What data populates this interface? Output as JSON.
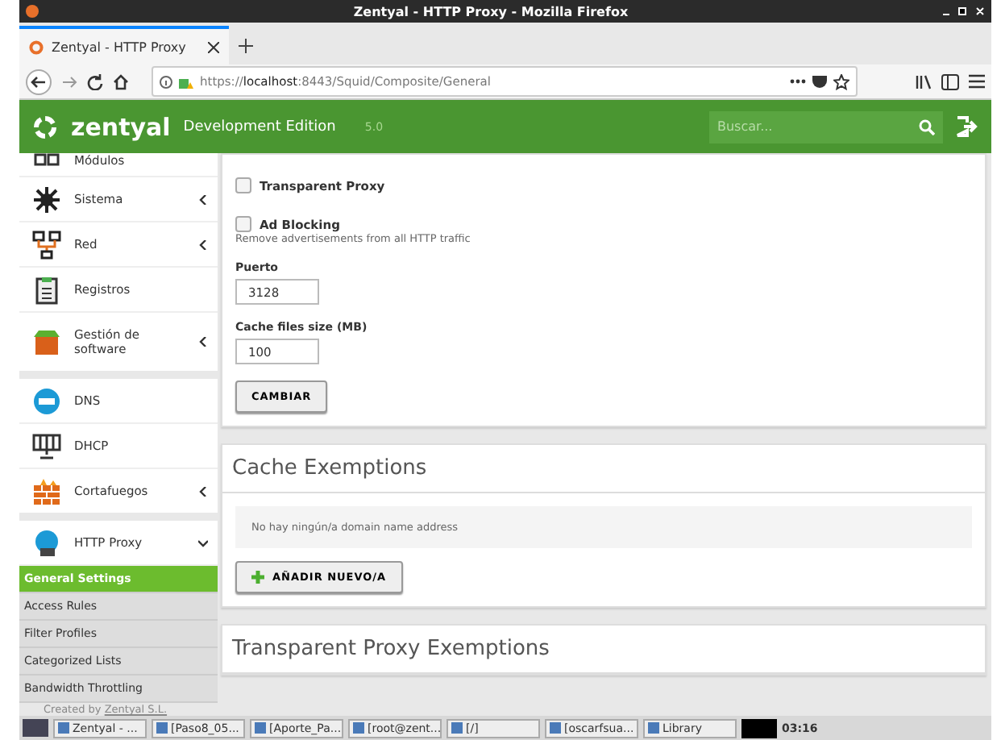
{
  "window": {
    "title": "Zentyal - HTTP Proxy - Mozilla Firefox"
  },
  "tabs": [
    {
      "title": "Zentyal - HTTP Proxy",
      "selected": true
    }
  ],
  "address_bar": {
    "scheme": "https://",
    "host": "localhost",
    "path": ":8443/Squid/Composite/General"
  },
  "header": {
    "brand": "zentyal",
    "edition": "Development Edition",
    "version": "5.0",
    "search": {
      "placeholder": "Buscar..."
    }
  },
  "sidebar": {
    "items": [
      {
        "label": "Módulos",
        "expandable": false,
        "group_end": false
      },
      {
        "label": "Sistema",
        "expandable": true,
        "expanded": false,
        "group_end": false
      },
      {
        "label": "Red",
        "expandable": true,
        "expanded": false,
        "group_end": false
      },
      {
        "label": "Registros",
        "expandable": false,
        "group_end": false
      },
      {
        "label": "Gestión de software",
        "expandable": true,
        "expanded": false,
        "group_end": true
      },
      {
        "label": "DNS",
        "expandable": false,
        "group_end": false
      },
      {
        "label": "DHCP",
        "expandable": false,
        "group_end": false
      },
      {
        "label": "Cortafuegos",
        "expandable": true,
        "expanded": false,
        "group_end": true
      },
      {
        "label": "HTTP Proxy",
        "expandable": true,
        "expanded": true,
        "group_end": false
      }
    ],
    "submenu": [
      {
        "label": "General Settings",
        "selected": true
      },
      {
        "label": "Access Rules",
        "selected": false
      },
      {
        "label": "Filter Profiles",
        "selected": false
      },
      {
        "label": "Categorized Lists",
        "selected": false
      },
      {
        "label": "Bandwidth Throttling",
        "selected": false
      }
    ],
    "footer": {
      "text": "Created by",
      "link": "Zentyal S.L."
    }
  },
  "settings": {
    "checkboxes": [
      {
        "label": "Transparent Proxy",
        "checked": false
      },
      {
        "label": "Ad Blocking",
        "checked": false,
        "hint": "Remove advertisements from all HTTP traffic"
      }
    ],
    "fields": [
      {
        "label": "Puerto",
        "value": "3128"
      },
      {
        "label": "Cache files size (MB)",
        "value": "100"
      }
    ],
    "button": "CAMBIAR"
  },
  "cache_exemptions": {
    "title": "Cache Exemptions",
    "empty_message": "No hay ningún/a domain name address",
    "add_button": "AÑADIR NUEVO/A"
  },
  "transparent_exemptions": {
    "title": "Transparent Proxy Exemptions"
  },
  "taskbar": {
    "tasks": [
      "Zentyal - ...",
      "[Paso8_05...",
      "[Aporte_Pa...",
      "[root@zent...",
      "[/]",
      "[oscarfsua...",
      "Library"
    ],
    "clock": "03:16"
  }
}
